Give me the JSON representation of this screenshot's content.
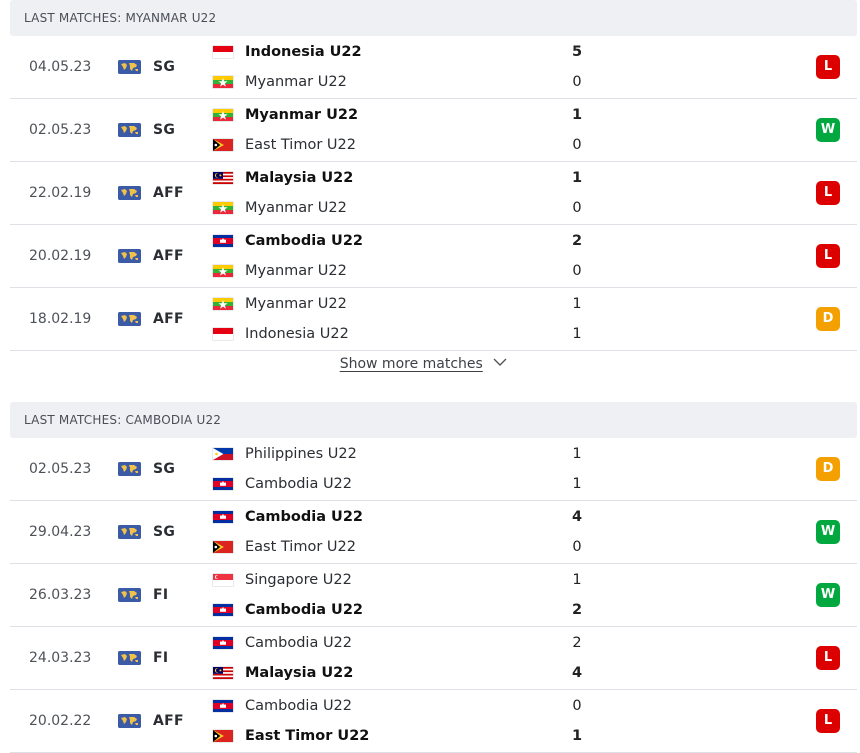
{
  "sections": [
    {
      "title": "LAST MATCHES: MYANMAR U22",
      "matches": [
        {
          "date": "04.05.23",
          "comp": "SG",
          "home": {
            "name": "Indonesia U22",
            "flag": "indonesia",
            "score": "5",
            "winner": true
          },
          "away": {
            "name": "Myanmar U22",
            "flag": "myanmar",
            "score": "0",
            "winner": false
          },
          "result": "L"
        },
        {
          "date": "02.05.23",
          "comp": "SG",
          "home": {
            "name": "Myanmar U22",
            "flag": "myanmar",
            "score": "1",
            "winner": true
          },
          "away": {
            "name": "East Timor U22",
            "flag": "east-timor",
            "score": "0",
            "winner": false
          },
          "result": "W"
        },
        {
          "date": "22.02.19",
          "comp": "AFF",
          "home": {
            "name": "Malaysia U22",
            "flag": "malaysia",
            "score": "1",
            "winner": true
          },
          "away": {
            "name": "Myanmar U22",
            "flag": "myanmar",
            "score": "0",
            "winner": false
          },
          "result": "L"
        },
        {
          "date": "20.02.19",
          "comp": "AFF",
          "home": {
            "name": "Cambodia U22",
            "flag": "cambodia",
            "score": "2",
            "winner": true
          },
          "away": {
            "name": "Myanmar U22",
            "flag": "myanmar",
            "score": "0",
            "winner": false
          },
          "result": "L"
        },
        {
          "date": "18.02.19",
          "comp": "AFF",
          "home": {
            "name": "Myanmar U22",
            "flag": "myanmar",
            "score": "1",
            "winner": false
          },
          "away": {
            "name": "Indonesia U22",
            "flag": "indonesia",
            "score": "1",
            "winner": false
          },
          "result": "D"
        }
      ]
    },
    {
      "title": "LAST MATCHES: CAMBODIA U22",
      "matches": [
        {
          "date": "02.05.23",
          "comp": "SG",
          "home": {
            "name": "Philippines U22",
            "flag": "philippines",
            "score": "1",
            "winner": false
          },
          "away": {
            "name": "Cambodia U22",
            "flag": "cambodia",
            "score": "1",
            "winner": false
          },
          "result": "D"
        },
        {
          "date": "29.04.23",
          "comp": "SG",
          "home": {
            "name": "Cambodia U22",
            "flag": "cambodia",
            "score": "4",
            "winner": true
          },
          "away": {
            "name": "East Timor U22",
            "flag": "east-timor",
            "score": "0",
            "winner": false
          },
          "result": "W"
        },
        {
          "date": "26.03.23",
          "comp": "FI",
          "home": {
            "name": "Singapore U22",
            "flag": "singapore",
            "score": "1",
            "winner": false
          },
          "away": {
            "name": "Cambodia U22",
            "flag": "cambodia",
            "score": "2",
            "winner": true
          },
          "result": "W"
        },
        {
          "date": "24.03.23",
          "comp": "FI",
          "home": {
            "name": "Cambodia U22",
            "flag": "cambodia",
            "score": "2",
            "winner": false
          },
          "away": {
            "name": "Malaysia U22",
            "flag": "malaysia",
            "score": "4",
            "winner": true
          },
          "result": "L"
        },
        {
          "date": "20.02.22",
          "comp": "AFF",
          "home": {
            "name": "Cambodia U22",
            "flag": "cambodia",
            "score": "0",
            "winner": false
          },
          "away": {
            "name": "East Timor U22",
            "flag": "east-timor",
            "score": "1",
            "winner": true
          },
          "result": "L"
        }
      ]
    }
  ],
  "show_more_label": "Show more matches",
  "show_more_icon": "chevron-down-icon",
  "competition_icon": "world-map-icon",
  "colors": {
    "L": "#dc0000",
    "W": "#00a83f",
    "D": "#f3a000",
    "header_bg": "#eef0f4"
  }
}
